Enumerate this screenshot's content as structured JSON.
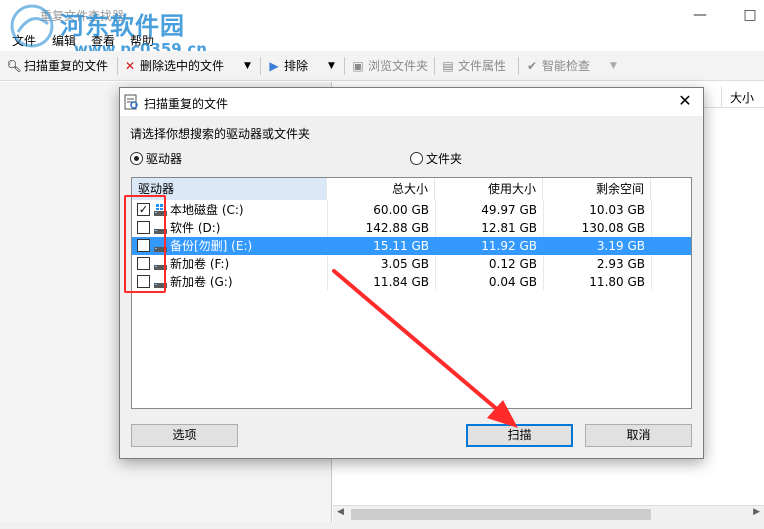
{
  "window": {
    "title": "重复文件查找器",
    "close_glyph": "×",
    "maximize_glyph": "□",
    "minimize_glyph": "—"
  },
  "watermark": {
    "text": "河东软件园",
    "url": "www.pc0359.cn"
  },
  "menu": {
    "items": [
      "文件",
      "编辑",
      "查看",
      "帮助"
    ]
  },
  "toolbar": {
    "scan": "扫描重复的文件",
    "delete_selected": "删除选中的文件",
    "exclude": "排除",
    "browse_folder": "浏览文件夹",
    "file_properties": "文件属性",
    "smart_check": "智能检查"
  },
  "right_pane": {
    "size_header": "大小"
  },
  "dialog": {
    "title": "扫描重复的文件",
    "close_glyph": "✕",
    "prompt": "请选择你想搜索的驱动器或文件夹",
    "radio_drive": "驱动器",
    "radio_folder": "文件夹",
    "selected_radio": "驱动器",
    "columns": [
      "驱动器",
      "总大小",
      "使用大小",
      "剩余空间"
    ],
    "drives": [
      {
        "name": "本地磁盘 (C:)",
        "total": "60.00 GB",
        "used": "49.97 GB",
        "free": "10.03 GB",
        "checked": true,
        "selected": false
      },
      {
        "name": "软件 (D:)",
        "total": "142.88 GB",
        "used": "12.81 GB",
        "free": "130.08 GB",
        "checked": false,
        "selected": false
      },
      {
        "name": "备份[勿删] (E:)",
        "total": "15.11 GB",
        "used": "11.92 GB",
        "free": "3.19 GB",
        "checked": false,
        "selected": true
      },
      {
        "name": "新加卷 (F:)",
        "total": "3.05 GB",
        "used": "0.12 GB",
        "free": "2.93 GB",
        "checked": false,
        "selected": false
      },
      {
        "name": "新加卷 (G:)",
        "total": "11.84 GB",
        "used": "0.04 GB",
        "free": "11.80 GB",
        "checked": false,
        "selected": false
      }
    ],
    "buttons": {
      "options": "选项",
      "scan": "扫描",
      "cancel": "取消"
    }
  },
  "colors": {
    "selection": "#3399ff",
    "annotation": "#ff2a2a",
    "default_button_border": "#0078d7",
    "watermark": "#2a8fd6"
  }
}
